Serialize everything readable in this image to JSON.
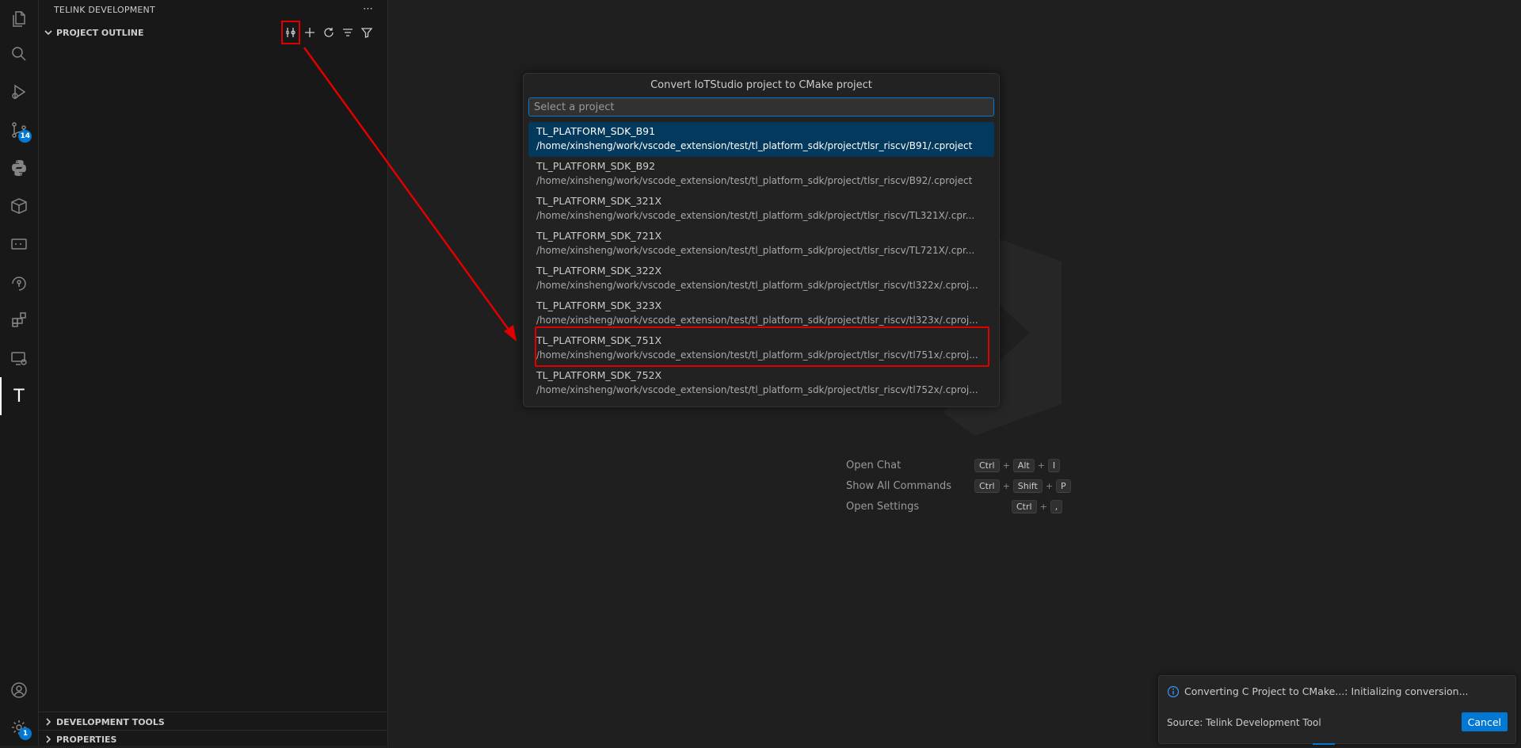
{
  "activity_bar": {
    "items": [
      {
        "icon": "explorer-icon"
      },
      {
        "icon": "search-icon"
      },
      {
        "icon": "run-debug-icon"
      },
      {
        "icon": "source-control-icon",
        "badge": "14"
      },
      {
        "icon": "python-icon"
      },
      {
        "icon": "packages-icon"
      },
      {
        "icon": "terminal-icon"
      },
      {
        "icon": "remote-icon"
      },
      {
        "icon": "extensions-icon"
      },
      {
        "icon": "remote-explorer-icon"
      },
      {
        "icon": "telink-icon",
        "letter": "T"
      }
    ],
    "accounts_icon": "account-icon",
    "settings_badge": "1"
  },
  "sidebar": {
    "title": "TELINK DEVELOPMENT",
    "more": "⋯",
    "outline_section": "PROJECT OUTLINE",
    "dev_tools_section": "DEVELOPMENT TOOLS",
    "properties_section": "PROPERTIES"
  },
  "quick_pick": {
    "title": "Convert IoTStudio project to CMake project",
    "placeholder": "Select a project",
    "items": [
      {
        "name": "TL_PLATFORM_SDK_B91",
        "path": "/home/xinsheng/work/vscode_extension/test/tl_platform_sdk/project/tlsr_riscv/B91/.cproject"
      },
      {
        "name": "TL_PLATFORM_SDK_B92",
        "path": "/home/xinsheng/work/vscode_extension/test/tl_platform_sdk/project/tlsr_riscv/B92/.cproject"
      },
      {
        "name": "TL_PLATFORM_SDK_321X",
        "path": "/home/xinsheng/work/vscode_extension/test/tl_platform_sdk/project/tlsr_riscv/TL321X/.cpr..."
      },
      {
        "name": "TL_PLATFORM_SDK_721X",
        "path": "/home/xinsheng/work/vscode_extension/test/tl_platform_sdk/project/tlsr_riscv/TL721X/.cpr..."
      },
      {
        "name": "TL_PLATFORM_SDK_322X",
        "path": "/home/xinsheng/work/vscode_extension/test/tl_platform_sdk/project/tlsr_riscv/tl322x/.cproj..."
      },
      {
        "name": "TL_PLATFORM_SDK_323X",
        "path": "/home/xinsheng/work/vscode_extension/test/tl_platform_sdk/project/tlsr_riscv/tl323x/.cproj..."
      },
      {
        "name": "TL_PLATFORM_SDK_751X",
        "path": "/home/xinsheng/work/vscode_extension/test/tl_platform_sdk/project/tlsr_riscv/tl751x/.cproj..."
      },
      {
        "name": "TL_PLATFORM_SDK_752X",
        "path": "/home/xinsheng/work/vscode_extension/test/tl_platform_sdk/project/tlsr_riscv/tl752x/.cproj..."
      }
    ]
  },
  "shortcuts": [
    {
      "label": "Open Chat",
      "keys": [
        "Ctrl",
        "Alt",
        "I"
      ]
    },
    {
      "label": "Show All Commands",
      "keys": [
        "Ctrl",
        "Shift",
        "P"
      ]
    },
    {
      "label": "Open Settings",
      "keys": [
        "Ctrl",
        ","
      ]
    }
  ],
  "notification": {
    "message": "Converting C Project to CMake...: Initializing conversion...",
    "source": "Source: Telink Development Tool",
    "cancel": "Cancel"
  },
  "colors": {
    "accent": "#0078d4",
    "highlight": "#e00000",
    "selection": "#04395e"
  }
}
